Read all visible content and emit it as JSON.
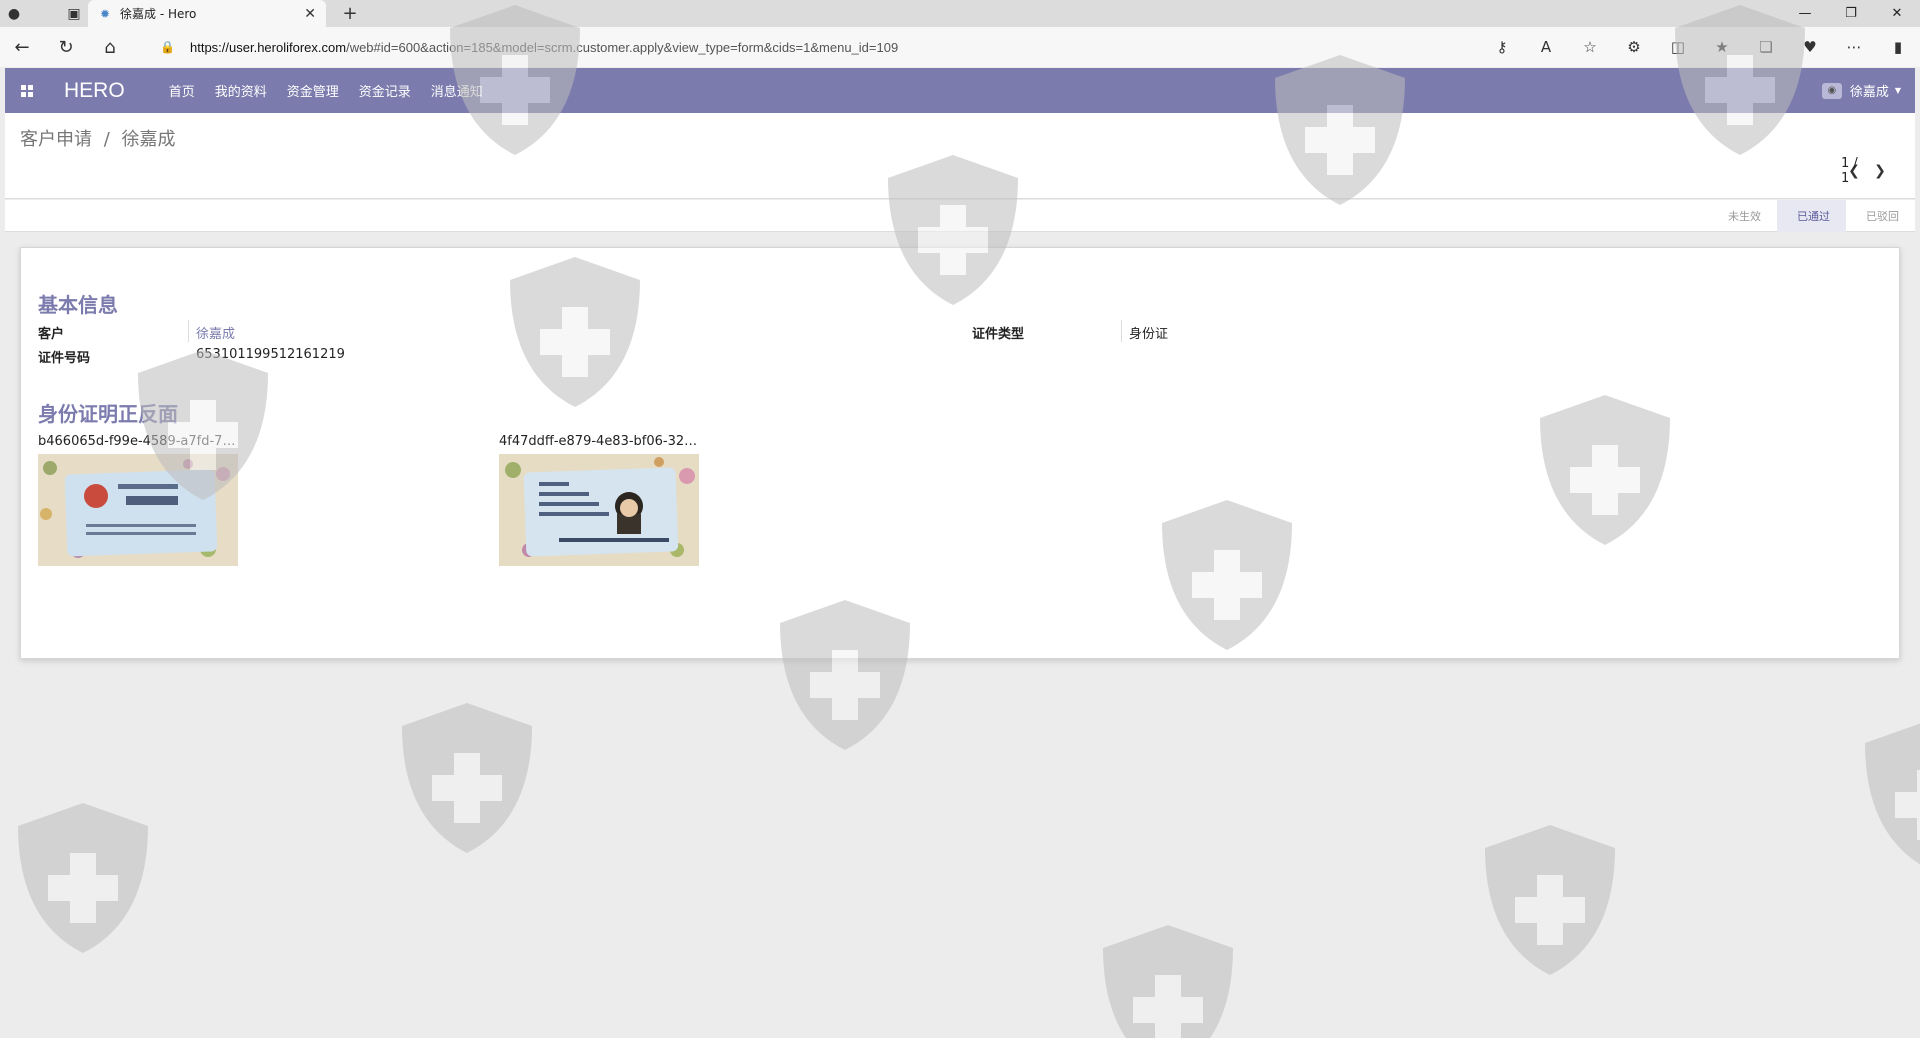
{
  "browser": {
    "tab_title": "徐嘉成 - Hero",
    "url_host": "https://user.heroliforex.com",
    "url_rest": "/web#id=600&action=185&model=scrm.customer.apply&view_type=form&cids=1&menu_id=109"
  },
  "navbar": {
    "brand": "HERO",
    "menu": [
      "首页",
      "我的资料",
      "资金管理",
      "资金记录",
      "消息通知"
    ],
    "user_name": "徐嘉成"
  },
  "control_panel": {
    "breadcrumb_parent": "客户申请",
    "breadcrumb_separator": "/",
    "breadcrumb_current": "徐嘉成",
    "pager_value": "1 / 1"
  },
  "statusbar": {
    "stages": [
      "未生效",
      "已通过",
      "已驳回"
    ],
    "active_stage": "已通过"
  },
  "form": {
    "basic_title": "基本信息",
    "customer_label": "客户",
    "customer_value": "徐嘉成",
    "id_type_label": "证件类型",
    "id_type_value": "身份证",
    "id_number_label": "证件号码",
    "id_number_value": "653101199512161219",
    "id_photos_title": "身份证明正反面",
    "attachments": [
      {
        "filename": "b466065d-f99e-4589-a7fd-736a..."
      },
      {
        "filename": "4f47ddff-e879-4e83-bf06-3290bf..."
      }
    ]
  },
  "colors": {
    "brand": "#7c7bad",
    "background": "#ececec"
  }
}
